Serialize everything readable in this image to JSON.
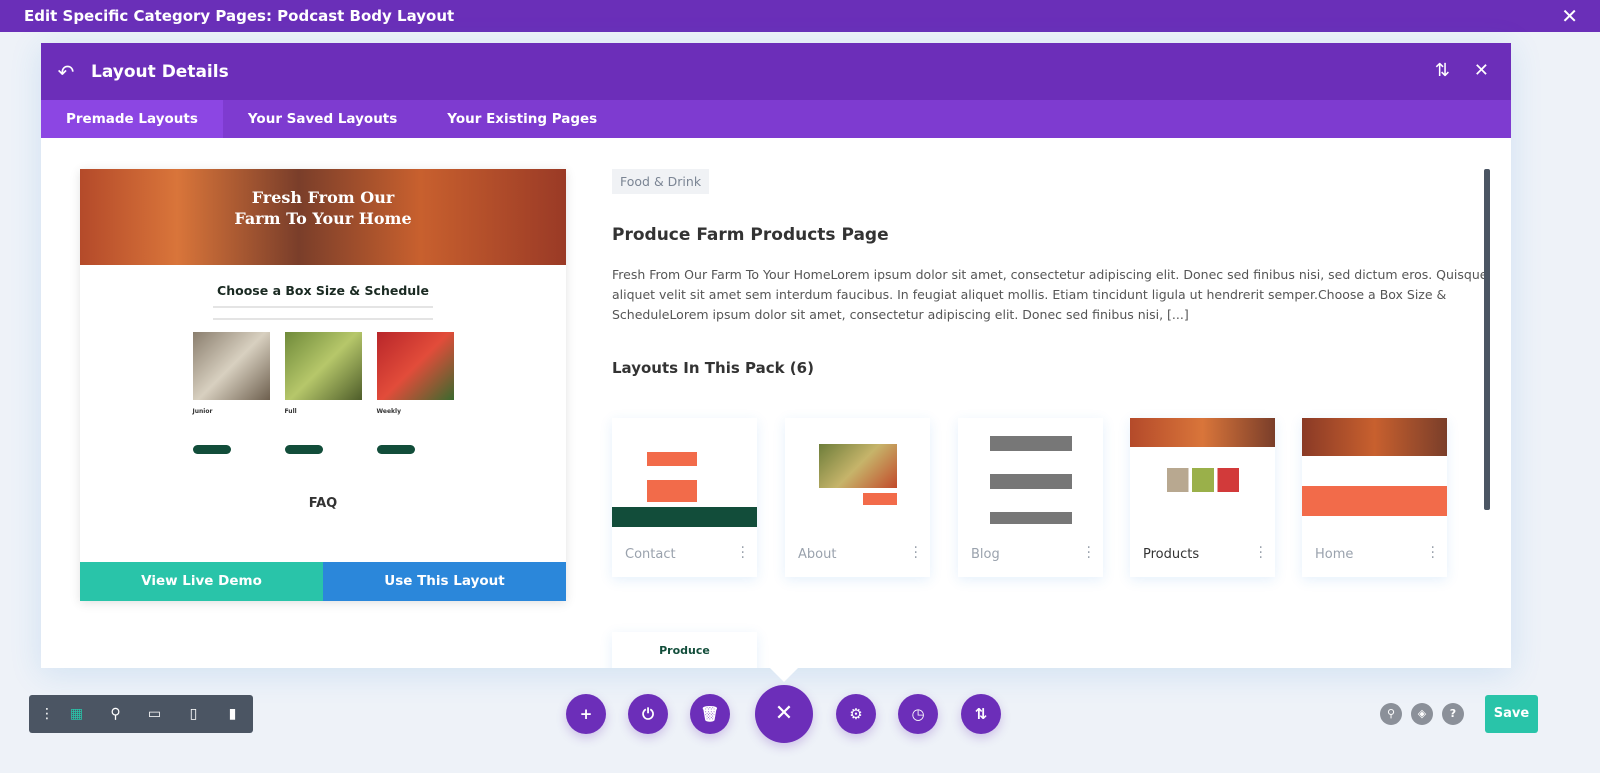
{
  "window": {
    "title": "Edit Specific Category Pages: Podcast Body Layout"
  },
  "modal": {
    "title": "Layout Details",
    "tabs": [
      {
        "label": "Premade Layouts",
        "active": true
      },
      {
        "label": "Your Saved Layouts"
      },
      {
        "label": "Your Existing Pages"
      }
    ]
  },
  "preview": {
    "hero": "Fresh From Our Farm To Your Home",
    "section": "Choose a Box Size & Schedule",
    "boxes": [
      "Junior",
      "Full",
      "Weekly"
    ],
    "faq": "FAQ",
    "view_demo": "View Live Demo",
    "use_layout": "Use This Layout"
  },
  "details": {
    "category": "Food & Drink",
    "title": "Produce Farm Products Page",
    "description": "Fresh From Our Farm To Your HomeLorem ipsum dolor sit amet, consectetur adipiscing elit. Donec sed finibus nisi, sed dictum eros. Quisque aliquet velit sit amet sem interdum faucibus. In feugiat aliquet mollis. Etiam tincidunt ligula ut hendrerit semper.Choose a Box Size & ScheduleLorem ipsum dolor sit amet, consectetur adipiscing elit. Donec sed finibus nisi, [...]",
    "pack_heading": "Layouts In This Pack (6)"
  },
  "pack": [
    {
      "label": "Contact"
    },
    {
      "label": "About"
    },
    {
      "label": "Blog"
    },
    {
      "label": "Products",
      "selected": true
    },
    {
      "label": "Home"
    },
    {
      "label": ""
    }
  ],
  "toolbar": {
    "save": "Save"
  },
  "colors": {
    "purple": "#6c2eb9",
    "teal": "#29c4a9",
    "blue": "#2b87da",
    "dark": "#4b5563"
  }
}
